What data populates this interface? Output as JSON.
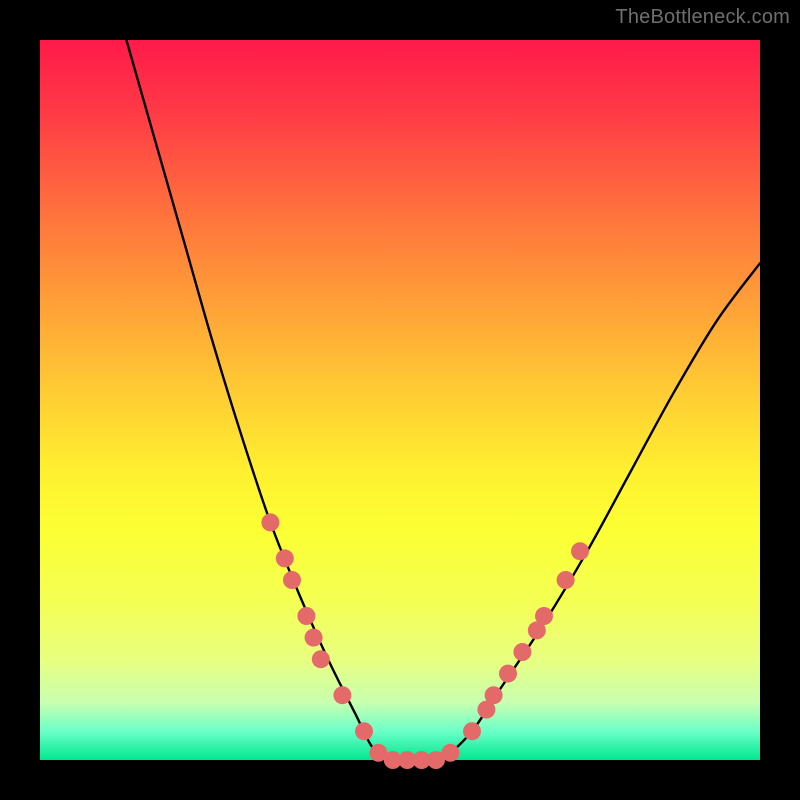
{
  "watermark": "TheBottleneck.com",
  "chart_data": {
    "type": "line",
    "title": "",
    "xlabel": "",
    "ylabel": "",
    "xlim": [
      0,
      100
    ],
    "ylim": [
      0,
      100
    ],
    "grid": false,
    "legend": false,
    "curve_left": {
      "name": "bottleneck-left",
      "x": [
        12,
        16,
        20,
        24,
        28,
        32,
        36,
        40,
        44,
        46,
        48
      ],
      "y": [
        100,
        86,
        72,
        58,
        45,
        33,
        23,
        14,
        6,
        2,
        0
      ]
    },
    "curve_flat": {
      "name": "optimal-flat",
      "x": [
        48,
        50,
        52,
        54,
        56
      ],
      "y": [
        0,
        0,
        0,
        0,
        0
      ]
    },
    "curve_right": {
      "name": "bottleneck-right",
      "x": [
        56,
        60,
        64,
        70,
        76,
        82,
        88,
        94,
        100
      ],
      "y": [
        0,
        4,
        10,
        19,
        29,
        40,
        51,
        61,
        69
      ]
    },
    "markers": {
      "name": "sample-points",
      "color": "#e46a6a",
      "radius_px": 9,
      "points": [
        {
          "x": 32,
          "y": 33
        },
        {
          "x": 34,
          "y": 28
        },
        {
          "x": 35,
          "y": 25
        },
        {
          "x": 37,
          "y": 20
        },
        {
          "x": 38,
          "y": 17
        },
        {
          "x": 39,
          "y": 14
        },
        {
          "x": 42,
          "y": 9
        },
        {
          "x": 45,
          "y": 4
        },
        {
          "x": 47,
          "y": 1
        },
        {
          "x": 49,
          "y": 0
        },
        {
          "x": 51,
          "y": 0
        },
        {
          "x": 53,
          "y": 0
        },
        {
          "x": 55,
          "y": 0
        },
        {
          "x": 57,
          "y": 1
        },
        {
          "x": 60,
          "y": 4
        },
        {
          "x": 62,
          "y": 7
        },
        {
          "x": 63,
          "y": 9
        },
        {
          "x": 65,
          "y": 12
        },
        {
          "x": 67,
          "y": 15
        },
        {
          "x": 69,
          "y": 18
        },
        {
          "x": 70,
          "y": 20
        },
        {
          "x": 73,
          "y": 25
        },
        {
          "x": 75,
          "y": 29
        }
      ]
    }
  }
}
